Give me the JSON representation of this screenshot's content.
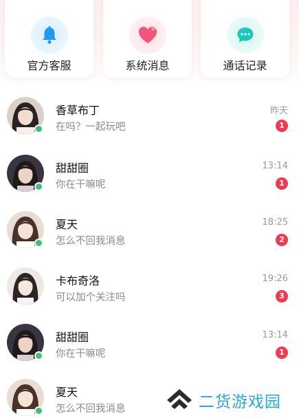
{
  "quick_actions": [
    {
      "label": "官方客服",
      "icon": "bell-icon",
      "color": "#1e9bf0"
    },
    {
      "label": "系统消息",
      "icon": "heart-icon",
      "color": "#f2557a"
    },
    {
      "label": "通话记录",
      "icon": "chat-bubble-icon",
      "color": "#1fc7b8"
    }
  ],
  "conversations": [
    {
      "name": "香草布丁",
      "message": "在吗？一起玩吧",
      "time": "昨天",
      "unread": "1",
      "online": true
    },
    {
      "name": "甜甜圈",
      "message": "你在干嘛呢",
      "time": "13:14",
      "unread": "1",
      "online": true
    },
    {
      "name": "夏天",
      "message": "怎么不回我消息",
      "time": "18:25",
      "unread": "2",
      "online": true
    },
    {
      "name": "卡布奇洛",
      "message": "可以加个关注吗",
      "time": "19:26",
      "unread": "3",
      "online": false
    },
    {
      "name": "甜甜圈",
      "message": "你在干嘛呢",
      "time": "13:14",
      "unread": "1",
      "online": true
    },
    {
      "name": "夏天",
      "message": "怎么不回我消息",
      "time": "",
      "unread": "",
      "online": true
    }
  ],
  "watermark": {
    "text": "二货游戏园"
  },
  "colors": {
    "accent_badge": "#ef3b52",
    "online": "#3fc07a",
    "muted_text": "#8b8b8b"
  }
}
